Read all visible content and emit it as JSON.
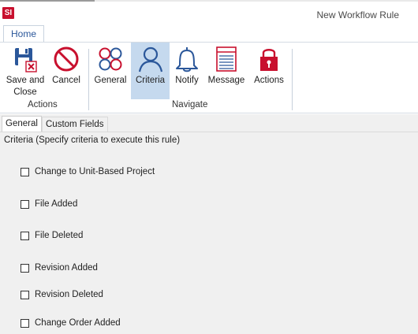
{
  "window": {
    "title": "New Workflow Rule",
    "logo": "SI"
  },
  "ribbon": {
    "home_tab": "Home",
    "actions_group": {
      "label": "Actions",
      "save_label_line1": "Save and",
      "save_label_line2": "Close",
      "cancel_label": "Cancel"
    },
    "navigate_group": {
      "label": "Navigate",
      "general_label": "General",
      "criteria_label": "Criteria",
      "notify_label": "Notify",
      "message_label": "Message",
      "actions_label": "Actions"
    },
    "icons": {
      "save": "save-close-icon",
      "cancel": "cancel-icon",
      "general": "general-circles-icon",
      "criteria": "person-icon",
      "notify": "bell-icon",
      "message": "message-list-icon",
      "actions": "lock-icon"
    },
    "colors": {
      "accent": "#c8102e",
      "icon_blue": "#2b579a",
      "selected_bg": "#c5d9ee"
    }
  },
  "page_tabs": {
    "general": "General",
    "custom_fields": "Custom Fields"
  },
  "criteria": {
    "heading": "Criteria (Specify criteria to execute this rule)",
    "items": [
      {
        "label": "Change to Unit-Based Project",
        "checked": false
      },
      {
        "label": "File Added",
        "checked": false
      },
      {
        "label": "File Deleted",
        "checked": false
      },
      {
        "label": "Revision Added",
        "checked": false
      },
      {
        "label": "Revision Deleted",
        "checked": false
      },
      {
        "label": "Change Order Added",
        "checked": false
      }
    ]
  }
}
